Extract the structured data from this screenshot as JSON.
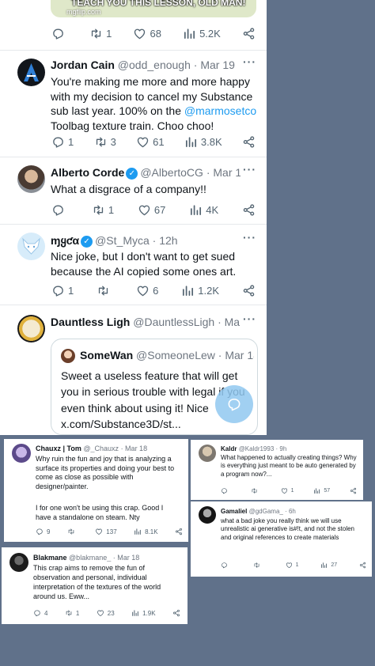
{
  "colors": {
    "background": "#60718a",
    "link": "#1d9bf0",
    "verified": "#1d9bf0",
    "muted": "#536471"
  },
  "top_tweet": {
    "image_caption": "TEACH YOU THIS LESSON, OLD MAN!",
    "image_watermark": "mgflip.com",
    "replies": "",
    "reposts": "1",
    "likes": "68",
    "views": "5.2K"
  },
  "tweets": [
    {
      "name": "Jordan Cain",
      "handle": "@odd_enough",
      "time": "· Mar 19",
      "text_before": "You're making me more and more happy with my decision to cancel my Substance sub last year. 100% on the ",
      "mention": "@marmosetco",
      "text_after": " Toolbag texture train. Choo choo!",
      "replies": "1",
      "reposts": "3",
      "likes": "61",
      "views": "3.8K"
    },
    {
      "name": "Alberto Corde",
      "handle": "@AlbertoCG",
      "time": "· Mar 18",
      "text": "What a disgrace of a company!!",
      "replies": "",
      "reposts": "1",
      "likes": "67",
      "views": "4K"
    },
    {
      "name": "ɱყƈα",
      "handle": "@St_Myca",
      "time": "· 12h",
      "text": "Nice joke, but I don't want to get sued because the AI copied some ones art.",
      "replies": "1",
      "reposts": "",
      "likes": "6",
      "views": "1.2K"
    },
    {
      "name": "Dauntless Ligh",
      "handle": "@DauntlessLigh",
      "time": "· Mar 18",
      "quote": {
        "name": "SomeWan",
        "handle": "@SomeoneLew",
        "time": "· Mar 18",
        "text": "Sweet a useless feature that will get you in serious trouble with legal if you even think about using it! Nice x.com/Substance3D/st..."
      }
    }
  ],
  "screenshots": [
    {
      "name": "Chauxz | Tom",
      "handle": "@_Chauxz",
      "time": "· Mar 18",
      "text": "Why ruin the fun and joy that is analyzing a surface its properties and doing your best to come as close as possible with designer/painter.",
      "text2": "I for one won't be using this crap. Good I have a standalone on steam. Nty",
      "replies": "9",
      "reposts": "",
      "likes": "137",
      "views": "8.1K"
    },
    {
      "name": "Kaldr",
      "handle": "@Kaldr1993",
      "time": "· 9h",
      "text": "What happened to actually creating things? Why is everything just meant to be auto generated by a program now?...",
      "replies": "",
      "reposts": "",
      "likes": "1",
      "views": "57"
    },
    {
      "name": "Gamaliel",
      "handle": "@gdGama_",
      "time": "· 6h",
      "text": "what a bad joke you really think we will use unrealistic ai generative is#!t, and not the stolen and original references to create materials",
      "replies": "",
      "reposts": "",
      "likes": "1",
      "views": "27"
    },
    {
      "name": "Blakmane",
      "handle": "@blakmane_",
      "time": "· Mar 18",
      "text": "This crap aims to remove the fun of observation and personal, individual interpretation of the textures of the world around us. Eww...",
      "replies": "4",
      "reposts": "1",
      "likes": "23",
      "views": "1.9K"
    }
  ]
}
